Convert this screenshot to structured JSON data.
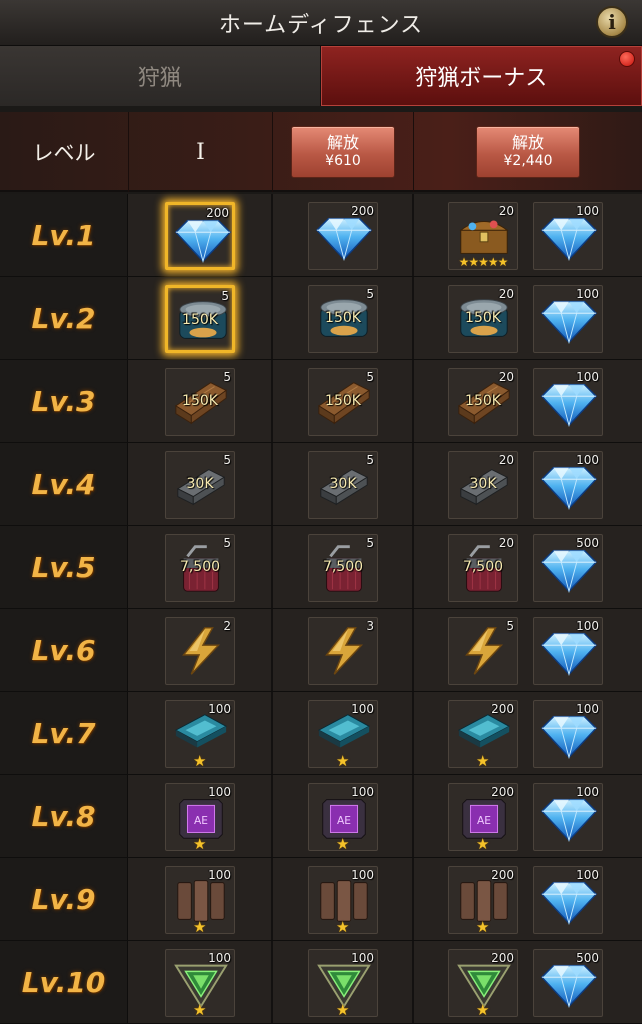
{
  "header": {
    "title": "ホームディフェンス",
    "info_icon": "info-icon"
  },
  "tabs": [
    {
      "label": "狩猟",
      "active": false
    },
    {
      "label": "狩猟ボーナス",
      "active": true,
      "badge": "red-dot"
    }
  ],
  "columns": {
    "level_header": "レベル",
    "tier1": "I",
    "unlock2": {
      "label": "解放",
      "price": "¥610"
    },
    "unlock3": {
      "label": "解放",
      "price": "¥2,440"
    }
  },
  "rows": [
    {
      "level": "Lv.1",
      "free": {
        "icon": "diamond-icon",
        "qty": "200",
        "selected": true
      },
      "t2": {
        "icon": "diamond-icon",
        "qty": "200"
      },
      "t3a": {
        "icon": "treasure-chest-icon",
        "qty": "20",
        "stars": "★★★★★"
      },
      "t3b": {
        "icon": "diamond-icon",
        "qty": "100"
      }
    },
    {
      "level": "Lv.2",
      "free": {
        "icon": "food-can-icon",
        "qty": "5",
        "amount": "150K",
        "selected": true
      },
      "t2": {
        "icon": "food-can-icon",
        "qty": "5",
        "amount": "150K"
      },
      "t3a": {
        "icon": "food-can-icon",
        "qty": "20",
        "amount": "150K"
      },
      "t3b": {
        "icon": "diamond-icon",
        "qty": "100"
      }
    },
    {
      "level": "Lv.3",
      "free": {
        "icon": "wood-icon",
        "qty": "5",
        "amount": "150K"
      },
      "t2": {
        "icon": "wood-icon",
        "qty": "5",
        "amount": "150K"
      },
      "t3a": {
        "icon": "wood-icon",
        "qty": "20",
        "amount": "150K"
      },
      "t3b": {
        "icon": "diamond-icon",
        "qty": "100"
      }
    },
    {
      "level": "Lv.4",
      "free": {
        "icon": "steel-icon",
        "qty": "5",
        "amount": "30K"
      },
      "t2": {
        "icon": "steel-icon",
        "qty": "5",
        "amount": "30K"
      },
      "t3a": {
        "icon": "steel-icon",
        "qty": "20",
        "amount": "30K"
      },
      "t3b": {
        "icon": "diamond-icon",
        "qty": "100"
      }
    },
    {
      "level": "Lv.5",
      "free": {
        "icon": "oil-can-icon",
        "qty": "5",
        "amount": "7,500"
      },
      "t2": {
        "icon": "oil-can-icon",
        "qty": "5",
        "amount": "7,500"
      },
      "t3a": {
        "icon": "oil-can-icon",
        "qty": "20",
        "amount": "7,500"
      },
      "t3b": {
        "icon": "diamond-icon",
        "qty": "500"
      }
    },
    {
      "level": "Lv.6",
      "free": {
        "icon": "lightning-icon",
        "qty": "2"
      },
      "t2": {
        "icon": "lightning-icon",
        "qty": "3"
      },
      "t3a": {
        "icon": "lightning-icon",
        "qty": "5"
      },
      "t3b": {
        "icon": "diamond-icon",
        "qty": "100"
      }
    },
    {
      "level": "Lv.7",
      "free": {
        "icon": "blue-chip-icon",
        "qty": "100",
        "star": "★"
      },
      "t2": {
        "icon": "blue-chip-icon",
        "qty": "100",
        "star": "★"
      },
      "t3a": {
        "icon": "blue-chip-icon",
        "qty": "200",
        "star": "★"
      },
      "t3b": {
        "icon": "diamond-icon",
        "qty": "100"
      }
    },
    {
      "level": "Lv.8",
      "free": {
        "icon": "purple-chip-icon",
        "qty": "100",
        "star": "★"
      },
      "t2": {
        "icon": "purple-chip-icon",
        "qty": "100",
        "star": "★"
      },
      "t3a": {
        "icon": "purple-chip-icon",
        "qty": "200",
        "star": "★"
      },
      "t3b": {
        "icon": "diamond-icon",
        "qty": "100"
      }
    },
    {
      "level": "Lv.9",
      "free": {
        "icon": "armor-plate-icon",
        "qty": "100",
        "star": "★"
      },
      "t2": {
        "icon": "armor-plate-icon",
        "qty": "100",
        "star": "★"
      },
      "t3a": {
        "icon": "armor-plate-icon",
        "qty": "200",
        "star": "★"
      },
      "t3b": {
        "icon": "diamond-icon",
        "qty": "100"
      }
    },
    {
      "level": "Lv.10",
      "free": {
        "icon": "green-emblem-icon",
        "qty": "100",
        "star": "★"
      },
      "t2": {
        "icon": "green-emblem-icon",
        "qty": "100",
        "star": "★"
      },
      "t3a": {
        "icon": "green-emblem-icon",
        "qty": "200",
        "star": "★"
      },
      "t3b": {
        "icon": "diamond-icon",
        "qty": "500"
      }
    }
  ],
  "colors": {
    "level_text": "#f2b446",
    "active_tab": "#8e2320",
    "unlock_button": "#c9624d",
    "selected_glow": "#f3b22a",
    "star": "#f4c22a"
  }
}
